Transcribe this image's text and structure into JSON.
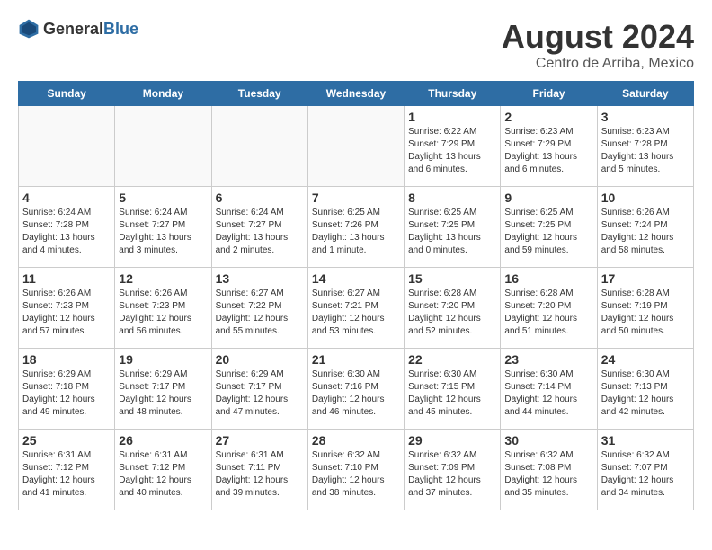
{
  "header": {
    "logo_general": "General",
    "logo_blue": "Blue",
    "main_title": "August 2024",
    "sub_title": "Centro de Arriba, Mexico"
  },
  "weekdays": [
    "Sunday",
    "Monday",
    "Tuesday",
    "Wednesday",
    "Thursday",
    "Friday",
    "Saturday"
  ],
  "weeks": [
    [
      {
        "day": "",
        "info": ""
      },
      {
        "day": "",
        "info": ""
      },
      {
        "day": "",
        "info": ""
      },
      {
        "day": "",
        "info": ""
      },
      {
        "day": "1",
        "info": "Sunrise: 6:22 AM\nSunset: 7:29 PM\nDaylight: 13 hours\nand 6 minutes."
      },
      {
        "day": "2",
        "info": "Sunrise: 6:23 AM\nSunset: 7:29 PM\nDaylight: 13 hours\nand 6 minutes."
      },
      {
        "day": "3",
        "info": "Sunrise: 6:23 AM\nSunset: 7:28 PM\nDaylight: 13 hours\nand 5 minutes."
      }
    ],
    [
      {
        "day": "4",
        "info": "Sunrise: 6:24 AM\nSunset: 7:28 PM\nDaylight: 13 hours\nand 4 minutes."
      },
      {
        "day": "5",
        "info": "Sunrise: 6:24 AM\nSunset: 7:27 PM\nDaylight: 13 hours\nand 3 minutes."
      },
      {
        "day": "6",
        "info": "Sunrise: 6:24 AM\nSunset: 7:27 PM\nDaylight: 13 hours\nand 2 minutes."
      },
      {
        "day": "7",
        "info": "Sunrise: 6:25 AM\nSunset: 7:26 PM\nDaylight: 13 hours\nand 1 minute."
      },
      {
        "day": "8",
        "info": "Sunrise: 6:25 AM\nSunset: 7:25 PM\nDaylight: 13 hours\nand 0 minutes."
      },
      {
        "day": "9",
        "info": "Sunrise: 6:25 AM\nSunset: 7:25 PM\nDaylight: 12 hours\nand 59 minutes."
      },
      {
        "day": "10",
        "info": "Sunrise: 6:26 AM\nSunset: 7:24 PM\nDaylight: 12 hours\nand 58 minutes."
      }
    ],
    [
      {
        "day": "11",
        "info": "Sunrise: 6:26 AM\nSunset: 7:23 PM\nDaylight: 12 hours\nand 57 minutes."
      },
      {
        "day": "12",
        "info": "Sunrise: 6:26 AM\nSunset: 7:23 PM\nDaylight: 12 hours\nand 56 minutes."
      },
      {
        "day": "13",
        "info": "Sunrise: 6:27 AM\nSunset: 7:22 PM\nDaylight: 12 hours\nand 55 minutes."
      },
      {
        "day": "14",
        "info": "Sunrise: 6:27 AM\nSunset: 7:21 PM\nDaylight: 12 hours\nand 53 minutes."
      },
      {
        "day": "15",
        "info": "Sunrise: 6:28 AM\nSunset: 7:20 PM\nDaylight: 12 hours\nand 52 minutes."
      },
      {
        "day": "16",
        "info": "Sunrise: 6:28 AM\nSunset: 7:20 PM\nDaylight: 12 hours\nand 51 minutes."
      },
      {
        "day": "17",
        "info": "Sunrise: 6:28 AM\nSunset: 7:19 PM\nDaylight: 12 hours\nand 50 minutes."
      }
    ],
    [
      {
        "day": "18",
        "info": "Sunrise: 6:29 AM\nSunset: 7:18 PM\nDaylight: 12 hours\nand 49 minutes."
      },
      {
        "day": "19",
        "info": "Sunrise: 6:29 AM\nSunset: 7:17 PM\nDaylight: 12 hours\nand 48 minutes."
      },
      {
        "day": "20",
        "info": "Sunrise: 6:29 AM\nSunset: 7:17 PM\nDaylight: 12 hours\nand 47 minutes."
      },
      {
        "day": "21",
        "info": "Sunrise: 6:30 AM\nSunset: 7:16 PM\nDaylight: 12 hours\nand 46 minutes."
      },
      {
        "day": "22",
        "info": "Sunrise: 6:30 AM\nSunset: 7:15 PM\nDaylight: 12 hours\nand 45 minutes."
      },
      {
        "day": "23",
        "info": "Sunrise: 6:30 AM\nSunset: 7:14 PM\nDaylight: 12 hours\nand 44 minutes."
      },
      {
        "day": "24",
        "info": "Sunrise: 6:30 AM\nSunset: 7:13 PM\nDaylight: 12 hours\nand 42 minutes."
      }
    ],
    [
      {
        "day": "25",
        "info": "Sunrise: 6:31 AM\nSunset: 7:12 PM\nDaylight: 12 hours\nand 41 minutes."
      },
      {
        "day": "26",
        "info": "Sunrise: 6:31 AM\nSunset: 7:12 PM\nDaylight: 12 hours\nand 40 minutes."
      },
      {
        "day": "27",
        "info": "Sunrise: 6:31 AM\nSunset: 7:11 PM\nDaylight: 12 hours\nand 39 minutes."
      },
      {
        "day": "28",
        "info": "Sunrise: 6:32 AM\nSunset: 7:10 PM\nDaylight: 12 hours\nand 38 minutes."
      },
      {
        "day": "29",
        "info": "Sunrise: 6:32 AM\nSunset: 7:09 PM\nDaylight: 12 hours\nand 37 minutes."
      },
      {
        "day": "30",
        "info": "Sunrise: 6:32 AM\nSunset: 7:08 PM\nDaylight: 12 hours\nand 35 minutes."
      },
      {
        "day": "31",
        "info": "Sunrise: 6:32 AM\nSunset: 7:07 PM\nDaylight: 12 hours\nand 34 minutes."
      }
    ]
  ]
}
